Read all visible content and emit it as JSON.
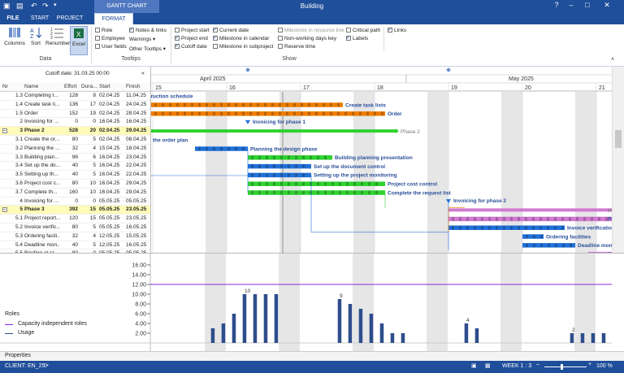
{
  "window": {
    "title": "Building",
    "context_tab": "GANTT CHART"
  },
  "tabs": [
    "FILE",
    "START",
    "PROJECT",
    "FORMAT"
  ],
  "ribbon": {
    "data_group": {
      "label": "Data",
      "columns": "Columns",
      "sort": "Sort",
      "renumber": "Renumber",
      "excel": "Excel"
    },
    "tooltips_group": {
      "label": "Tooltips",
      "role": "Role",
      "employee": "Employee",
      "user_fields": "User fields",
      "notes_links": "Notes & links",
      "warnings": "Warnings",
      "other_tooltips": "Other Tooltips"
    },
    "show_group": {
      "label": "Show",
      "project_start": "Project start",
      "project_end": "Project end",
      "cutoff_date": "Cutoff date",
      "current_date": "Current date",
      "milestone_calendar": "Milestone in calendar",
      "milestone_subproject": "Milestone in subproject",
      "milestone_resource": "Milestone in resource line",
      "non_working_key": "Non-working days key",
      "reserve_time": "Reserve time",
      "critical_path": "Critical path",
      "labels": "Labels",
      "links": "Links"
    }
  },
  "cutoff": "Cutoff date: 31.03.25 00:00",
  "columns": {
    "nr": "Nr",
    "name": "Name",
    "effort": "Effort",
    "duration": "Dura...",
    "start": "Start",
    "finish": "Finish"
  },
  "tasks": [
    {
      "nr": "1.3",
      "name": "Completing t...",
      "effort": "128",
      "dur": "8",
      "start": "02.04.25",
      "finish": "11.04.25"
    },
    {
      "nr": "1.4",
      "name": "Create task li...",
      "effort": "136",
      "dur": "17",
      "start": "02.04.25",
      "finish": "24.04.25"
    },
    {
      "nr": "1.5",
      "name": "Order",
      "effort": "152",
      "dur": "19",
      "start": "02.04.25",
      "finish": "28.04.25"
    },
    {
      "nr": "2",
      "name": "Invoicing for ...",
      "effort": "0",
      "dur": "0",
      "start": "16.04.25",
      "finish": "16.04.25"
    },
    {
      "nr": "3",
      "name": "Phase 2",
      "effort": "528",
      "dur": "20",
      "start": "02.04.25",
      "finish": "29.04.25",
      "summary": true
    },
    {
      "nr": "3.1",
      "name": "Create the or...",
      "effort": "80",
      "dur": "5",
      "start": "02.04.25",
      "finish": "08.04.25"
    },
    {
      "nr": "3.2",
      "name": "Planning the ...",
      "effort": "32",
      "dur": "4",
      "start": "15.04.25",
      "finish": "18.04.25"
    },
    {
      "nr": "3.3",
      "name": "Building plan...",
      "effort": "96",
      "dur": "6",
      "start": "16.04.25",
      "finish": "23.04.25"
    },
    {
      "nr": "3.4",
      "name": "Set up the do...",
      "effort": "40",
      "dur": "5",
      "start": "16.04.25",
      "finish": "22.04.25"
    },
    {
      "nr": "3.5",
      "name": "Setting up th...",
      "effort": "40",
      "dur": "5",
      "start": "16.04.25",
      "finish": "22.04.25"
    },
    {
      "nr": "3.6",
      "name": "Project cost c...",
      "effort": "80",
      "dur": "10",
      "start": "16.04.25",
      "finish": "29.04.25"
    },
    {
      "nr": "3.7",
      "name": "Complete th...",
      "effort": "160",
      "dur": "10",
      "start": "16.04.25",
      "finish": "29.04.25"
    },
    {
      "nr": "4",
      "name": "Invoicing for ...",
      "effort": "0",
      "dur": "0",
      "start": "05.05.25",
      "finish": "05.05.25"
    },
    {
      "nr": "5",
      "name": "Phase 3",
      "effort": "392",
      "dur": "15",
      "start": "05.05.25",
      "finish": "23.05.25",
      "summary": true
    },
    {
      "nr": "5.1",
      "name": "Project report...",
      "effort": "120",
      "dur": "15",
      "start": "05.05.25",
      "finish": "23.05.25"
    },
    {
      "nr": "5.2",
      "name": "Invoice verific...",
      "effort": "80",
      "dur": "5",
      "start": "05.05.25",
      "finish": "16.05.25"
    },
    {
      "nr": "5.3",
      "name": "Ordering facili...",
      "effort": "32",
      "dur": "4",
      "start": "12.05.25",
      "finish": "15.05.25"
    },
    {
      "nr": "5.4",
      "name": "Deadline mon...",
      "effort": "40",
      "dur": "5",
      "start": "12.05.25",
      "finish": "16.05.25"
    },
    {
      "nr": "5.5",
      "name": "Briefing at st...",
      "effort": "80",
      "dur": "0",
      "start": "05.05.25",
      "finish": "05.05.25"
    }
  ],
  "timeline": {
    "months": [
      {
        "label": "April 2025"
      },
      {
        "label": "May 2025"
      }
    ],
    "weeks": [
      "15",
      "16",
      "17",
      "18",
      "19",
      "20",
      "21"
    ]
  },
  "bar_labels": {
    "completing": "Completing the construction schedule",
    "task_lists": "Create task lists",
    "order": "Order",
    "invoicing1": "Invoicing for phase 1",
    "phase2": "Phase 2",
    "order_plan": "the order plan",
    "design": "Planning the design phase",
    "building_pres": "Building planning presentation",
    "doc_control": "Set up the document control",
    "monitoring": "Setting up the project monitoring",
    "cost_control": "Project cost control",
    "request_list": "Complete the request list",
    "invoicing2": "Invoicing for phase 2",
    "pha": "Pha",
    "pro": "Pro",
    "inv_ver": "Invoice verification",
    "ord_fac": "Ordering facilities",
    "deadline": "Deadline monitoring",
    "bri": "Bri"
  },
  "histogram": {
    "y_ticks": [
      "16.00",
      "14.00",
      "12.00",
      "10.00",
      "8.00",
      "6.00",
      "4.00",
      "2.00"
    ],
    "capacity": 12,
    "peak_labels": [
      "10",
      "9",
      "4",
      "2",
      "5",
      "3"
    ]
  },
  "legend": {
    "title": "Roles",
    "capacity": "Capacity independent roles",
    "usage": "Usage"
  },
  "properties": "Properties",
  "status": {
    "client": "CLIENT: EN_25",
    "week": "WEEK 1 : 3",
    "zoom": "100 %"
  },
  "colors": {
    "brand": "#1f4e9a",
    "orange": "#f07d00",
    "green": "#2fd12f",
    "blue": "#2070d8",
    "pink": "#d07ad0",
    "capacity": "#8a2be2",
    "bar": "#2e4d8c"
  }
}
